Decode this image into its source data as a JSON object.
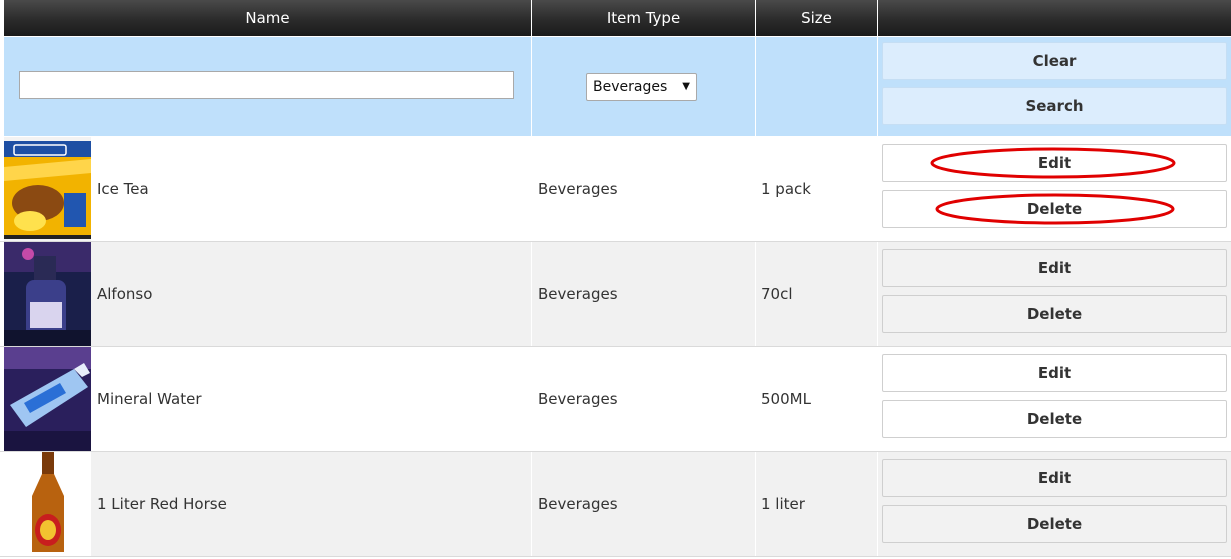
{
  "table": {
    "columns": {
      "name": "Name",
      "item_type": "Item Type",
      "size": "Size",
      "actions": ""
    },
    "filters": {
      "name_value": "",
      "name_placeholder": "",
      "item_type_selected": "Beverages",
      "clear_label": "Clear",
      "search_label": "Search"
    },
    "rows": [
      {
        "name": "Ice Tea",
        "item_type": "Beverages",
        "size": "1 pack",
        "thumbnail": "ice-tea-packet-image",
        "edit_label": "Edit",
        "delete_label": "Delete",
        "highlighted": true
      },
      {
        "name": "Alfonso",
        "item_type": "Beverages",
        "size": "70cl",
        "thumbnail": "alfonso-bottle-image",
        "edit_label": "Edit",
        "delete_label": "Delete",
        "highlighted": false
      },
      {
        "name": "Mineral Water",
        "item_type": "Beverages",
        "size": "500ML",
        "thumbnail": "mineral-water-bottle-image",
        "edit_label": "Edit",
        "delete_label": "Delete",
        "highlighted": false
      },
      {
        "name": "1 Liter Red Horse",
        "item_type": "Beverages",
        "size": "1 liter",
        "thumbnail": "red-horse-bottle-image",
        "edit_label": "Edit",
        "delete_label": "Delete",
        "highlighted": false
      }
    ]
  },
  "colors": {
    "header_dark": "#2b2b2b",
    "filter_row": "#bfe0fb",
    "button_blue": "#dcedfd",
    "row_alt": "#f1f1f1",
    "annotation_red": "#e00000"
  }
}
